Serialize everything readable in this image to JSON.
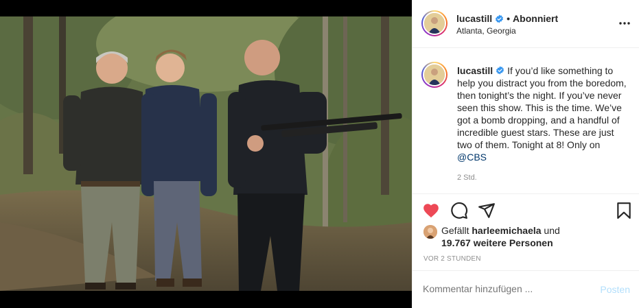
{
  "post": {
    "username": "lucastill",
    "follow_separator": "•",
    "follow_state": "Abonniert",
    "location": "Atlanta, Georgia"
  },
  "caption": {
    "username": "lucastill",
    "text": "If you’d like something to help you distract you from the boredom, then tonight’s the night. If you’ve never seen this show. This is the time. We’ve got a bomb dropping, and a handful of incredible guest stars. These are just two of them. Tonight at 8! Only on ",
    "mention": "@CBS",
    "time_ago": "2 Std."
  },
  "likes": {
    "prefix": "Gefällt",
    "liker": "harleemichaela",
    "connector": "und",
    "count_text": "19.767 weitere Personen"
  },
  "posted": "VOR 2 STUNDEN",
  "comment": {
    "placeholder": "Kommentar hinzufügen ...",
    "post_label": "Posten"
  },
  "icons": {
    "like": "heart-icon",
    "comment": "speech-bubble-icon",
    "share": "paper-plane-icon",
    "save": "bookmark-icon",
    "more": "more-options-icon",
    "verified": "verified-badge-icon"
  },
  "colors": {
    "like_red": "#ed4956",
    "verified_blue": "#3897f0",
    "link": "#00376b",
    "post_disabled": "#b2dffc",
    "muted": "#8e8e8e"
  }
}
